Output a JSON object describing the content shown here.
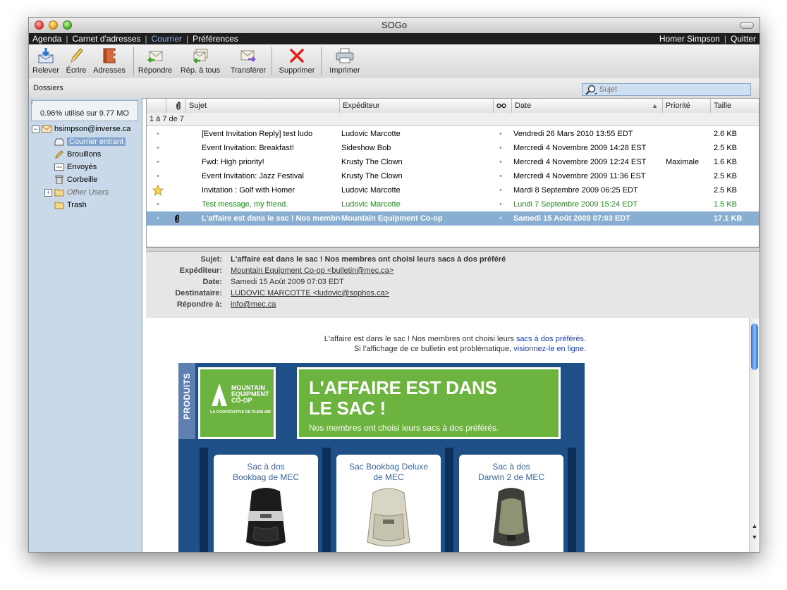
{
  "window": {
    "title": "SOGo"
  },
  "nav": {
    "items": [
      "Agenda",
      "Carnet d'adresses",
      "Courrier",
      "Préférences"
    ],
    "active": "Courrier",
    "user": "Homer Simpson",
    "logout": "Quitter"
  },
  "toolbar": {
    "buttons": [
      {
        "label": "Relever",
        "icon": "get-mail-icon"
      },
      {
        "label": "Écrire",
        "icon": "pencil-icon"
      },
      {
        "label": "Adresses",
        "icon": "address-book-icon"
      },
      {
        "label": "Répondre",
        "icon": "reply-icon"
      },
      {
        "label": "Rép. à tous",
        "icon": "reply-all-icon"
      },
      {
        "label": "Transférer",
        "icon": "forward-icon"
      },
      {
        "label": "Supprimer",
        "icon": "delete-x-icon"
      },
      {
        "label": "Imprimer",
        "icon": "printer-icon"
      }
    ]
  },
  "folders": {
    "label": "Dossiers",
    "quota_text": "0.96% utilisé sur 9.77 MO",
    "quota_percent": 0.96,
    "account": "hsimpson@inverse.ca",
    "items": [
      {
        "name": "Courrier entrant",
        "selected": true
      },
      {
        "name": "Brouillons"
      },
      {
        "name": "Envoyés"
      },
      {
        "name": "Corbeille"
      },
      {
        "name": "Other Users",
        "italic": true
      },
      {
        "name": "Trash"
      }
    ]
  },
  "search": {
    "placeholder": "Sujet"
  },
  "messages": {
    "columns": [
      "Sujet",
      "Expéditeur",
      "Date",
      "Priorité",
      "Taille"
    ],
    "count": "1 à 7 de 7",
    "rows": [
      {
        "subject": "[Event Invitation Reply] test ludo",
        "from": "Ludovic Marcotte",
        "date": "Vendredi 26 Mars 2010 13:55 EDT",
        "priority": "",
        "size": "2.6 KB"
      },
      {
        "subject": "Event Invitation: Breakfast!",
        "from": "Sideshow Bob",
        "date": "Mercredi 4 Novembre 2009 14:28 EST",
        "priority": "",
        "size": "2.5 KB"
      },
      {
        "subject": "Fwd: High priority!",
        "from": "Krusty The Clown",
        "date": "Mercredi 4 Novembre 2009 12:24 EST",
        "priority": "Maximale",
        "size": "1.6 KB"
      },
      {
        "subject": "Event Invitation: Jazz Festival",
        "from": "Krusty The Clown",
        "date": "Mercredi 4 Novembre 2009 11:36 EST",
        "priority": "",
        "size": "2.5 KB"
      },
      {
        "subject": "Invitation : Golf with Homer",
        "from": "Ludovic Marcotte",
        "date": "Mardi 8 Septembre 2009 06:25 EDT",
        "priority": "",
        "size": "2.5 KB",
        "flagged": true
      },
      {
        "subject": "Test message, my friend.",
        "from": "Ludovic Marcotte",
        "date": "Lundi 7 Septembre 2009 15:24 EDT",
        "priority": "",
        "size": "1.5 KB",
        "green": true
      },
      {
        "subject": "L'affaire est dans le sac ! Nos membre",
        "from": "Mountain Equipment Co-op",
        "date": "Samedi 15 Août 2009 07:03 EDT",
        "priority": "",
        "size": "17.1 KB",
        "selected": true,
        "attachment": true
      }
    ]
  },
  "message": {
    "labels": {
      "subject": "Sujet:",
      "from": "Expéditeur:",
      "date": "Date:",
      "to": "Destinataire:",
      "reply_to": "Répondre à:"
    },
    "subject": "L'affaire est dans le sac ! Nos membres ont choisi leurs sacs à dos préféré",
    "from": "Mountain Equipment Co-op <bulletin@mec.ca>",
    "date": "Samedi 15 Août 2009 07:03 EDT",
    "to": "LUDOVIC MARCOTTE <ludovic@sophos.ca>",
    "reply_to": "info@mec.ca"
  },
  "email": {
    "line1_text": "L'affaire est dans le sac ! Nos membres ont choisi leurs ",
    "line1_link": "sacs à dos préférés",
    "line1_end": ".",
    "line2_text": "Si l'affichage de ce bulletin est problématique, ",
    "line2_link": "visionnez-le en ligne",
    "line2_end": ".",
    "side_tab": "PRODUITS",
    "logo": {
      "line1": "MOUNTAIN",
      "line2": "EQUIPMENT",
      "line3": "CO-OP",
      "tagline": "LA COOPÉRATIVE DE PLEIN AIR"
    },
    "headline1": "L'AFFAIRE EST DANS",
    "headline2": "LE SAC !",
    "subline": "Nos membres ont choisi leurs sacs à dos préférés.",
    "products": [
      {
        "line1": "Sac à dos",
        "line2": "Bookbag de MEC"
      },
      {
        "line1": "Sac Bookbag Deluxe",
        "line2": "de MEC"
      },
      {
        "line1": "Sac à dos",
        "line2": "Darwin 2 de MEC"
      }
    ]
  },
  "colors": {
    "selection": "#88aed2",
    "sidebar": "#c9d9ea",
    "accent_green": "#6db33f",
    "promo_blue": "#1e4f86"
  }
}
